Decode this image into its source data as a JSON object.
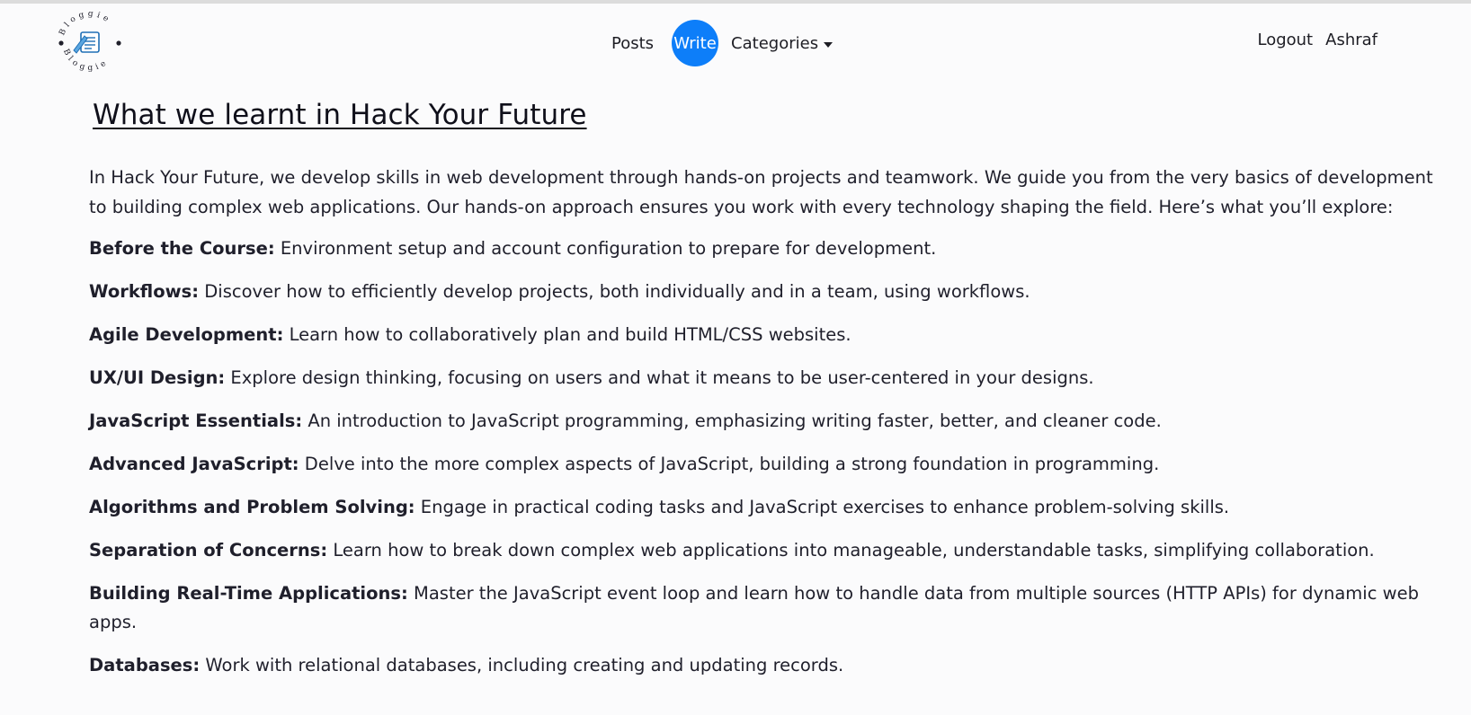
{
  "nav": {
    "logo_text": "Bloggie",
    "links": {
      "posts": "Posts",
      "write": "Write",
      "categories": "Categories"
    },
    "right": {
      "logout": "Logout",
      "user": "Ashraf"
    },
    "accent_color": "#0d7ef9"
  },
  "article": {
    "title": "What we learnt in Hack Your Future",
    "intro": "In Hack Your Future, we develop skills in web development through hands-on projects and teamwork. We guide you from the very basics of development to building complex web applications. Our hands-on approach ensures you work with every technology shaping the field. Here’s what you’ll explore:",
    "items": [
      {
        "label": "Before the Course:",
        "text": " Environment setup and account configuration to prepare for development."
      },
      {
        "label": "Workflows:",
        "text": " Discover how to efficiently develop projects, both individually and in a team, using workflows."
      },
      {
        "label": "Agile Development:",
        "text": " Learn how to collaboratively plan and build HTML/CSS websites."
      },
      {
        "label": "UX/UI Design:",
        "text": " Explore design thinking, focusing on users and what it means to be user-centered in your designs."
      },
      {
        "label": "JavaScript Essentials:",
        "text": " An introduction to JavaScript programming, emphasizing writing faster, better, and cleaner code."
      },
      {
        "label": "Advanced JavaScript:",
        "text": " Delve into the more complex aspects of JavaScript, building a strong foundation in programming."
      },
      {
        "label": "Algorithms and Problem Solving:",
        "text": " Engage in practical coding tasks and JavaScript exercises to enhance problem-solving skills."
      },
      {
        "label": "Separation of Concerns:",
        "text": " Learn how to break down complex web applications into manageable, understandable tasks, simplifying collaboration."
      },
      {
        "label": "Building Real-Time Applications:",
        "text": " Master the JavaScript event loop and learn how to handle data from multiple sources (HTTP APIs) for dynamic web apps."
      },
      {
        "label": "Databases:",
        "text": " Work with relational databases, including creating and updating records."
      }
    ]
  }
}
